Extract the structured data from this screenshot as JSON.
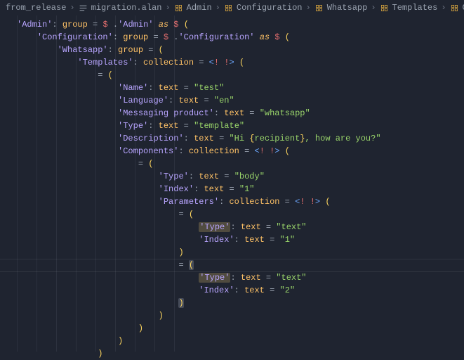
{
  "breadcrumbs": [
    {
      "label": "from_release",
      "icon": "none"
    },
    {
      "label": "migration.alan",
      "icon": "file"
    },
    {
      "label": "Admin",
      "icon": "struct"
    },
    {
      "label": "Configuration",
      "icon": "struct"
    },
    {
      "label": "Whatsapp",
      "icon": "struct"
    },
    {
      "label": "Templates",
      "icon": "struct"
    },
    {
      "label": "Components",
      "icon": "struct"
    }
  ],
  "code": {
    "lines": [
      {
        "key": "Admin",
        "decl": "group",
        "rhs": "$ .'Admin' as $ (",
        "indent": 0
      },
      {
        "key": "Configuration",
        "decl": "group",
        "rhs": "$ .'Configuration' as $ (",
        "indent": 1
      },
      {
        "key": "Whatsapp",
        "decl": "group",
        "rhs": "(",
        "indent": 2
      },
      {
        "key": "Templates",
        "decl": "collection",
        "rhs": "<! !> (",
        "indent": 3
      },
      {
        "eqparen": true,
        "indent": 4
      },
      {
        "key": "Name",
        "decl": "text",
        "str": "test",
        "indent": 5
      },
      {
        "key": "Language",
        "decl": "text",
        "str": "en",
        "indent": 5
      },
      {
        "key": "Messaging product",
        "decl": "text",
        "str": "whatsapp",
        "indent": 5
      },
      {
        "key": "Type",
        "decl": "text",
        "str": "template",
        "indent": 5
      },
      {
        "key": "Description",
        "decl": "text",
        "interp": {
          "pre": "Hi ",
          "var": "recipient",
          "post": ", how are you?"
        },
        "indent": 5
      },
      {
        "key": "Components",
        "decl": "collection",
        "rhs": "<! !> (",
        "indent": 5
      },
      {
        "eqparen": true,
        "indent": 6
      },
      {
        "key": "Type",
        "decl": "text",
        "str": "body",
        "indent": 7
      },
      {
        "key": "Index",
        "decl": "text",
        "str": "1",
        "indent": 7
      },
      {
        "key": "Parameters",
        "decl": "collection",
        "rhs": "<! !> (",
        "indent": 7
      },
      {
        "eqparen": true,
        "indent": 8
      },
      {
        "key": "Type",
        "decl": "text",
        "str": "text",
        "hlKey": true,
        "indent": 9
      },
      {
        "key": "Index",
        "decl": "text",
        "str": "1",
        "indent": 9
      },
      {
        "close": ")",
        "indent": 8
      },
      {
        "eqparen": true,
        "hlBracket": true,
        "indent": 8,
        "currentLine": true
      },
      {
        "key": "Type",
        "decl": "text",
        "str": "text",
        "hlKey": true,
        "indent": 9
      },
      {
        "key": "Index",
        "decl": "text",
        "str": "2",
        "indent": 9
      },
      {
        "close": ")",
        "hlBracket": true,
        "indent": 8
      },
      {
        "close": ")",
        "indent": 7
      },
      {
        "close": ")",
        "indent": 6
      },
      {
        "close": ")",
        "indent": 5
      },
      {
        "close": ")",
        "indent": 4
      }
    ]
  },
  "colors": {
    "background": "#1f2430",
    "key": "#b8a5ff",
    "keyword": "#ffc266",
    "string": "#99d46a",
    "dollar": "#e66f6f",
    "paren": "#ffd75f",
    "highlight": "rgba(255,216,120,0.22)"
  }
}
